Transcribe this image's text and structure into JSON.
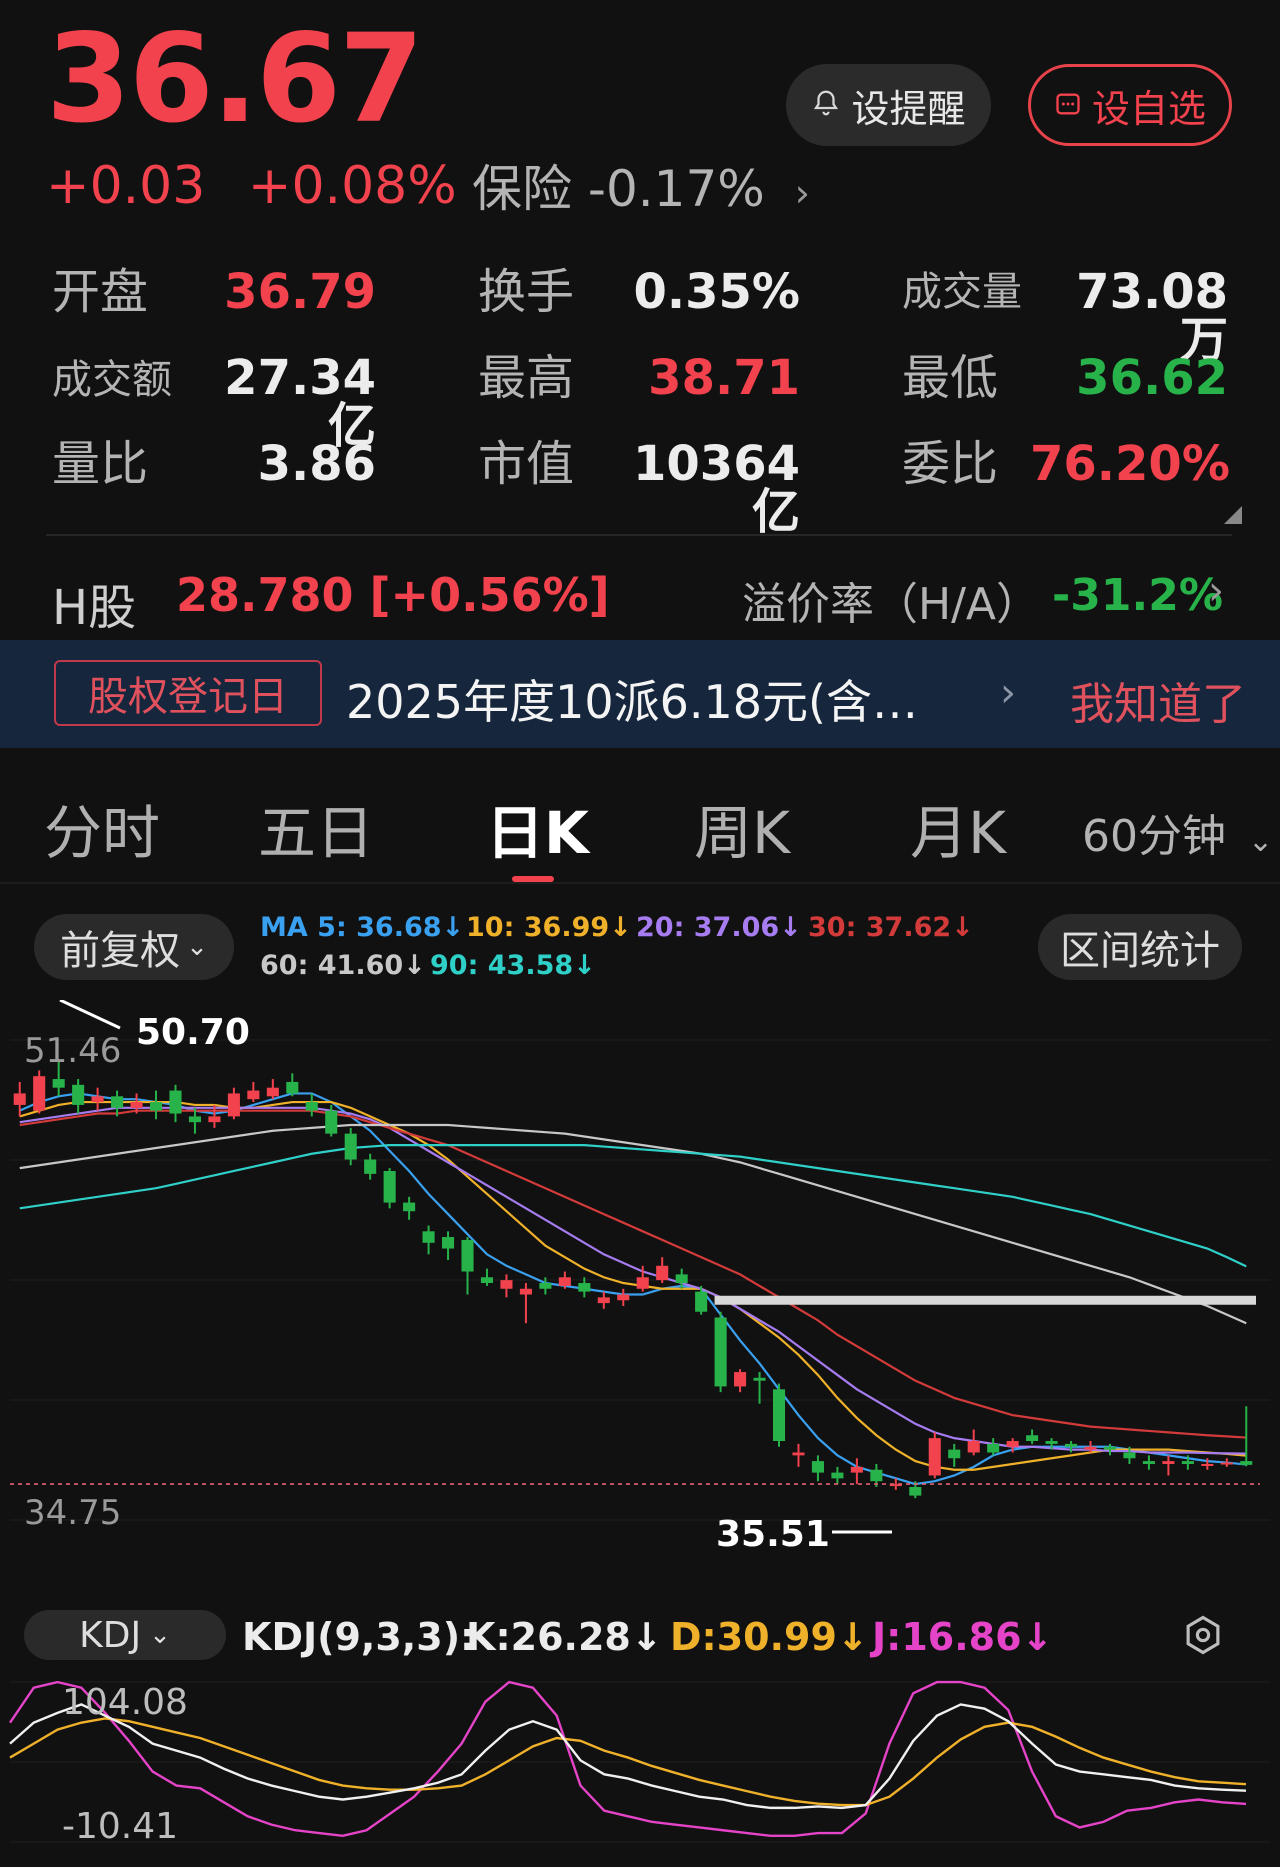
{
  "quote": {
    "price": "36.67",
    "change": "+0.03",
    "change_pct": "+0.08%",
    "sector_name": "保险",
    "sector_pct": "-0.17%"
  },
  "actions": {
    "remind_label": "设提醒",
    "favorite_label": "设自选"
  },
  "stats": {
    "open_label": "开盘",
    "open": "36.79",
    "turnover_label": "换手",
    "turnover": "0.35%",
    "volume_label": "成交量",
    "volume": "73.08万",
    "amount_label": "成交额",
    "amount": "27.34亿",
    "high_label": "最高",
    "high": "38.71",
    "low_label": "最低",
    "low": "36.62",
    "vol_ratio_label": "量比",
    "vol_ratio": "3.86",
    "mkt_cap_label": "市值",
    "mkt_cap": "10364亿",
    "bid_ratio_label": "委比",
    "bid_ratio": "76.20%"
  },
  "hshare": {
    "label": "H股",
    "value": "28.780 [+0.56%]",
    "premium_label": "溢价率（H/A）",
    "premium_value": "-31.2%"
  },
  "notice": {
    "tag": "股权登记日",
    "text": "2025年度10派6.18元(含…",
    "dismiss": "我知道了"
  },
  "tabs": [
    "分时",
    "五日",
    "日K",
    "周K",
    "月K"
  ],
  "active_tab": "日K",
  "period_dropdown": "60分钟",
  "chart_header": {
    "adjust_label": "前复权",
    "range_stats_label": "区间统计",
    "ma": [
      {
        "label": "MA 5: 36.68↓",
        "color": "#3aa0f0"
      },
      {
        "label": "10: 36.99↓",
        "color": "#f0b12a"
      },
      {
        "label": "20: 37.06↓",
        "color": "#a67cf0"
      },
      {
        "label": "30: 37.62↓",
        "color": "#d33b3b"
      },
      {
        "label": "60: 41.60↓",
        "color": "#c8c8c8"
      },
      {
        "label": "90: 43.58↓",
        "color": "#2fd0c8"
      }
    ]
  },
  "price_axis": {
    "top_label": "51.46",
    "bottom_label": "34.75",
    "max_marker": "50.70",
    "min_marker": "35.51"
  },
  "chart_data": {
    "type": "candlestick",
    "candles": [
      {
        "o": 49.2,
        "c": 49.6,
        "h": 50.0,
        "l": 48.8
      },
      {
        "o": 49.0,
        "c": 50.2,
        "h": 50.4,
        "l": 48.9
      },
      {
        "o": 50.1,
        "c": 49.8,
        "h": 50.7,
        "l": 49.5
      },
      {
        "o": 49.9,
        "c": 49.2,
        "h": 50.1,
        "l": 48.9
      },
      {
        "o": 49.3,
        "c": 49.5,
        "h": 49.8,
        "l": 49.0
      },
      {
        "o": 49.5,
        "c": 49.1,
        "h": 49.7,
        "l": 48.8
      },
      {
        "o": 49.1,
        "c": 49.3,
        "h": 49.6,
        "l": 48.9
      },
      {
        "o": 49.3,
        "c": 49.0,
        "h": 49.7,
        "l": 48.7
      },
      {
        "o": 49.7,
        "c": 48.9,
        "h": 49.9,
        "l": 48.6
      },
      {
        "o": 48.8,
        "c": 48.6,
        "h": 49.1,
        "l": 48.2
      },
      {
        "o": 48.6,
        "c": 48.8,
        "h": 49.2,
        "l": 48.4
      },
      {
        "o": 48.8,
        "c": 49.6,
        "h": 49.8,
        "l": 48.7
      },
      {
        "o": 49.4,
        "c": 49.7,
        "h": 50.0,
        "l": 49.3
      },
      {
        "o": 49.5,
        "c": 49.8,
        "h": 50.1,
        "l": 49.4
      },
      {
        "o": 50.0,
        "c": 49.6,
        "h": 50.3,
        "l": 49.5
      },
      {
        "o": 49.3,
        "c": 49.0,
        "h": 49.6,
        "l": 48.8
      },
      {
        "o": 49.0,
        "c": 48.2,
        "h": 49.2,
        "l": 48.1
      },
      {
        "o": 48.2,
        "c": 47.3,
        "h": 48.4,
        "l": 47.1
      },
      {
        "o": 47.3,
        "c": 46.8,
        "h": 47.5,
        "l": 46.6
      },
      {
        "o": 46.9,
        "c": 45.8,
        "h": 47.0,
        "l": 45.6
      },
      {
        "o": 45.8,
        "c": 45.5,
        "h": 46.0,
        "l": 45.2
      },
      {
        "o": 44.8,
        "c": 44.4,
        "h": 45.0,
        "l": 44.0
      },
      {
        "o": 44.6,
        "c": 44.2,
        "h": 44.8,
        "l": 43.8
      },
      {
        "o": 44.5,
        "c": 43.4,
        "h": 44.6,
        "l": 42.6
      },
      {
        "o": 43.2,
        "c": 43.0,
        "h": 43.5,
        "l": 42.9
      },
      {
        "o": 42.8,
        "c": 43.1,
        "h": 43.3,
        "l": 42.5
      },
      {
        "o": 42.6,
        "c": 42.8,
        "h": 43.0,
        "l": 41.6
      },
      {
        "o": 43.0,
        "c": 42.8,
        "h": 43.2,
        "l": 42.6
      },
      {
        "o": 42.9,
        "c": 43.2,
        "h": 43.4,
        "l": 42.8
      },
      {
        "o": 43.0,
        "c": 42.7,
        "h": 43.2,
        "l": 42.5
      },
      {
        "o": 42.3,
        "c": 42.5,
        "h": 42.7,
        "l": 42.1
      },
      {
        "o": 42.4,
        "c": 42.6,
        "h": 42.8,
        "l": 42.2
      },
      {
        "o": 42.8,
        "c": 43.2,
        "h": 43.6,
        "l": 42.7
      },
      {
        "o": 43.1,
        "c": 43.6,
        "h": 43.9,
        "l": 43.0
      },
      {
        "o": 43.3,
        "c": 43.0,
        "h": 43.5,
        "l": 42.8
      },
      {
        "o": 42.7,
        "c": 42.0,
        "h": 42.9,
        "l": 41.9
      },
      {
        "o": 41.8,
        "c": 39.4,
        "h": 42.0,
        "l": 39.2
      },
      {
        "o": 39.4,
        "c": 39.9,
        "h": 40.0,
        "l": 39.2
      },
      {
        "o": 39.7,
        "c": 39.6,
        "h": 39.9,
        "l": 38.8
      },
      {
        "o": 39.3,
        "c": 37.5,
        "h": 39.5,
        "l": 37.3
      },
      {
        "o": 37.0,
        "c": 37.1,
        "h": 37.4,
        "l": 36.6
      },
      {
        "o": 36.8,
        "c": 36.4,
        "h": 37.0,
        "l": 36.1
      },
      {
        "o": 36.4,
        "c": 36.2,
        "h": 36.6,
        "l": 36.0
      },
      {
        "o": 36.4,
        "c": 36.6,
        "h": 36.9,
        "l": 36.0
      },
      {
        "o": 36.5,
        "c": 36.1,
        "h": 36.7,
        "l": 35.9
      },
      {
        "o": 36.0,
        "c": 36.0,
        "h": 36.2,
        "l": 35.8
      },
      {
        "o": 35.9,
        "c": 35.6,
        "h": 36.1,
        "l": 35.51
      },
      {
        "o": 36.3,
        "c": 37.6,
        "h": 37.8,
        "l": 36.2
      },
      {
        "o": 37.2,
        "c": 36.9,
        "h": 37.4,
        "l": 36.6
      },
      {
        "o": 37.1,
        "c": 37.5,
        "h": 37.9,
        "l": 37.0
      },
      {
        "o": 37.4,
        "c": 37.1,
        "h": 37.6,
        "l": 37.0
      },
      {
        "o": 37.3,
        "c": 37.5,
        "h": 37.6,
        "l": 37.1
      },
      {
        "o": 37.7,
        "c": 37.5,
        "h": 37.9,
        "l": 37.4
      },
      {
        "o": 37.5,
        "c": 37.4,
        "h": 37.6,
        "l": 37.2
      },
      {
        "o": 37.4,
        "c": 37.3,
        "h": 37.5,
        "l": 37.1
      },
      {
        "o": 37.2,
        "c": 37.3,
        "h": 37.5,
        "l": 37.1
      },
      {
        "o": 37.3,
        "c": 37.2,
        "h": 37.4,
        "l": 37.0
      },
      {
        "o": 37.1,
        "c": 36.9,
        "h": 37.3,
        "l": 36.7
      },
      {
        "o": 36.8,
        "c": 36.7,
        "h": 37.0,
        "l": 36.5
      },
      {
        "o": 36.7,
        "c": 36.8,
        "h": 37.0,
        "l": 36.3
      },
      {
        "o": 36.8,
        "c": 36.7,
        "h": 37.0,
        "l": 36.5
      },
      {
        "o": 36.7,
        "c": 36.7,
        "h": 36.9,
        "l": 36.5
      },
      {
        "o": 36.7,
        "c": 36.75,
        "h": 36.9,
        "l": 36.6
      },
      {
        "o": 36.8,
        "c": 36.67,
        "h": 38.71,
        "l": 36.62
      }
    ],
    "ma_series": [
      {
        "name": "MA 5",
        "color": "#3aa0f0",
        "values": [
          49.0,
          49.3,
          49.5,
          49.6,
          49.5,
          49.4,
          49.4,
          49.3,
          49.2,
          49.0,
          48.9,
          49.0,
          49.2,
          49.4,
          49.6,
          49.6,
          49.3,
          48.8,
          48.3,
          47.6,
          46.9,
          46.1,
          45.4,
          44.7,
          44.0,
          43.6,
          43.3,
          43.0,
          42.9,
          42.8,
          42.7,
          42.6,
          42.6,
          42.8,
          42.9,
          42.8,
          41.9,
          41.0,
          40.2,
          39.3,
          38.4,
          37.6,
          37.0,
          36.6,
          36.4,
          36.2,
          36.0,
          36.1,
          36.3,
          36.6,
          37.0,
          37.2,
          37.3,
          37.3,
          37.3,
          37.3,
          37.3,
          37.2,
          37.1,
          37.0,
          36.9,
          36.8,
          36.75,
          36.68
        ]
      },
      {
        "name": "10",
        "color": "#f0b12a",
        "values": [
          48.8,
          49.0,
          49.2,
          49.3,
          49.3,
          49.3,
          49.3,
          49.3,
          49.3,
          49.2,
          49.2,
          49.1,
          49.1,
          49.2,
          49.3,
          49.3,
          49.3,
          49.1,
          48.8,
          48.5,
          48.2,
          47.8,
          47.3,
          46.7,
          46.1,
          45.5,
          44.9,
          44.3,
          43.9,
          43.5,
          43.2,
          43.0,
          42.9,
          42.8,
          42.8,
          42.8,
          42.5,
          42.1,
          41.6,
          41.1,
          40.5,
          39.8,
          39.0,
          38.3,
          37.7,
          37.2,
          36.8,
          36.6,
          36.5,
          36.5,
          36.6,
          36.7,
          36.8,
          36.9,
          37.0,
          37.1,
          37.2,
          37.2,
          37.2,
          37.2,
          37.15,
          37.1,
          37.05,
          36.99
        ]
      },
      {
        "name": "20",
        "color": "#a67cf0",
        "values": [
          48.6,
          48.7,
          48.8,
          48.9,
          49.0,
          49.1,
          49.1,
          49.1,
          49.1,
          49.1,
          49.1,
          49.1,
          49.1,
          49.1,
          49.1,
          49.1,
          49.0,
          48.9,
          48.7,
          48.4,
          48.0,
          47.6,
          47.2,
          46.8,
          46.4,
          46.0,
          45.6,
          45.2,
          44.8,
          44.4,
          44.0,
          43.7,
          43.4,
          43.2,
          43.0,
          42.8,
          42.5,
          42.1,
          41.7,
          41.3,
          40.8,
          40.3,
          39.8,
          39.3,
          38.9,
          38.5,
          38.1,
          37.8,
          37.6,
          37.5,
          37.4,
          37.3,
          37.3,
          37.25,
          37.2,
          37.2,
          37.15,
          37.15,
          37.1,
          37.1,
          37.1,
          37.08,
          37.07,
          37.06
        ]
      },
      {
        "name": "30",
        "color": "#d33b3b",
        "values": [
          48.5,
          48.6,
          48.7,
          48.8,
          48.9,
          48.9,
          49.0,
          49.0,
          49.0,
          49.0,
          49.0,
          49.0,
          49.0,
          49.0,
          49.0,
          49.0,
          48.9,
          48.8,
          48.6,
          48.4,
          48.2,
          48.0,
          47.8,
          47.5,
          47.2,
          46.9,
          46.6,
          46.3,
          46.0,
          45.7,
          45.4,
          45.1,
          44.8,
          44.5,
          44.2,
          43.9,
          43.6,
          43.3,
          42.9,
          42.5,
          42.1,
          41.7,
          41.2,
          40.8,
          40.4,
          40.0,
          39.6,
          39.3,
          39.0,
          38.8,
          38.6,
          38.4,
          38.3,
          38.2,
          38.1,
          38.0,
          37.95,
          37.9,
          37.85,
          37.8,
          37.75,
          37.7,
          37.66,
          37.62
        ]
      },
      {
        "name": "60",
        "color": "#c8c8c8",
        "values": [
          47.0,
          47.1,
          47.2,
          47.3,
          47.4,
          47.5,
          47.6,
          47.7,
          47.8,
          47.9,
          48.0,
          48.1,
          48.2,
          48.3,
          48.35,
          48.4,
          48.45,
          48.5,
          48.5,
          48.5,
          48.5,
          48.5,
          48.5,
          48.45,
          48.4,
          48.35,
          48.3,
          48.25,
          48.2,
          48.1,
          48.0,
          47.9,
          47.8,
          47.7,
          47.6,
          47.5,
          47.35,
          47.2,
          47.0,
          46.8,
          46.6,
          46.4,
          46.2,
          46.0,
          45.8,
          45.6,
          45.4,
          45.2,
          45.0,
          44.8,
          44.6,
          44.4,
          44.2,
          44.0,
          43.8,
          43.6,
          43.4,
          43.2,
          42.95,
          42.7,
          42.45,
          42.2,
          41.9,
          41.6
        ]
      },
      {
        "name": "90",
        "color": "#2fd0c8",
        "values": [
          45.6,
          45.7,
          45.8,
          45.9,
          46.0,
          46.1,
          46.2,
          46.3,
          46.45,
          46.6,
          46.75,
          46.9,
          47.05,
          47.2,
          47.35,
          47.5,
          47.6,
          47.7,
          47.75,
          47.8,
          47.8,
          47.8,
          47.8,
          47.8,
          47.8,
          47.8,
          47.8,
          47.8,
          47.8,
          47.8,
          47.75,
          47.7,
          47.65,
          47.6,
          47.55,
          47.5,
          47.45,
          47.4,
          47.3,
          47.2,
          47.1,
          47.0,
          46.9,
          46.8,
          46.7,
          46.6,
          46.5,
          46.4,
          46.3,
          46.2,
          46.1,
          46.0,
          45.85,
          45.7,
          45.55,
          45.4,
          45.2,
          45.0,
          44.8,
          44.6,
          44.4,
          44.2,
          43.9,
          43.58
        ]
      }
    ],
    "resistance_line": 42.4,
    "reference_line": 36.0,
    "ylim": [
      34.75,
      51.46
    ]
  },
  "kdj": {
    "selector_label": "KDJ",
    "params": "KDJ(9,3,3):",
    "k_label": "K:26.28↓",
    "d_label": "D:30.99↓",
    "j_label": "J:16.86↓",
    "axis_top": "104.08",
    "axis_bottom": "-10.41",
    "ylim": [
      -10.41,
      104.08
    ],
    "K": [
      60,
      75,
      82,
      88,
      80,
      72,
      60,
      55,
      50,
      42,
      35,
      30,
      26,
      22,
      20,
      22,
      25,
      28,
      32,
      38,
      55,
      70,
      76,
      70,
      48,
      38,
      35,
      30,
      26,
      22,
      20,
      16,
      14,
      14,
      15,
      14,
      16,
      35,
      62,
      80,
      88,
      85,
      76,
      60,
      45,
      40,
      38,
      36,
      34,
      30,
      28,
      27,
      26.28
    ],
    "D": [
      50,
      60,
      70,
      75,
      78,
      76,
      72,
      68,
      64,
      58,
      52,
      46,
      40,
      34,
      30,
      28,
      27,
      27,
      28,
      30,
      38,
      48,
      58,
      64,
      62,
      55,
      50,
      44,
      39,
      34,
      30,
      26,
      22,
      19,
      17,
      16,
      16,
      22,
      35,
      50,
      63,
      72,
      75,
      72,
      65,
      57,
      50,
      45,
      40,
      36,
      33,
      32,
      30.99
    ],
    "J": [
      75,
      100,
      104,
      100,
      82,
      62,
      40,
      30,
      28,
      18,
      8,
      2,
      -2,
      -4,
      -6,
      -2,
      10,
      22,
      40,
      60,
      90,
      104,
      100,
      80,
      30,
      12,
      8,
      4,
      2,
      0,
      -2,
      -4,
      -6,
      -6,
      -4,
      -4,
      10,
      60,
      96,
      104,
      104,
      100,
      84,
      40,
      8,
      0,
      4,
      12,
      14,
      18,
      20,
      18,
      16.86
    ]
  }
}
